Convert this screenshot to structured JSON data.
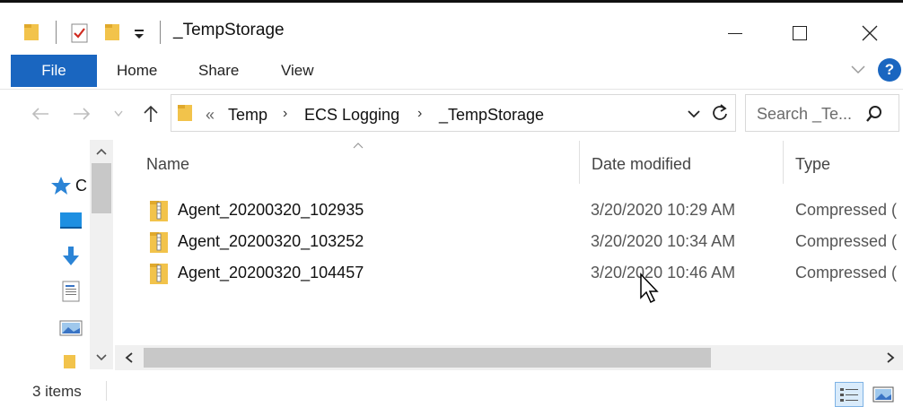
{
  "window": {
    "title": "_TempStorage",
    "minimize_glyph": "—",
    "maximize_glyph": "☐",
    "close_glyph": "✕"
  },
  "ribbon": {
    "file_label": "File",
    "tabs": [
      "Home",
      "Share",
      "View"
    ],
    "help_glyph": "?"
  },
  "address": {
    "overflow": "«",
    "crumbs": [
      "Temp",
      "ECS Logging",
      "_TempStorage"
    ],
    "separator": "›",
    "search_placeholder": "Search _Te..."
  },
  "columns": {
    "name": "Name",
    "date": "Date modified",
    "type": "Type"
  },
  "files": [
    {
      "name": "Agent_20200320_102935",
      "date": "3/20/2020 10:29 AM",
      "type": "Compressed ("
    },
    {
      "name": "Agent_20200320_103252",
      "date": "3/20/2020 10:34 AM",
      "type": "Compressed ("
    },
    {
      "name": "Agent_20200320_104457",
      "date": "3/20/2020 10:46 AM",
      "type": "Compressed ("
    }
  ],
  "nav": {
    "quick_access_partial": "C"
  },
  "status": {
    "items_text": "3 items"
  },
  "colors": {
    "accent": "#1a66c0",
    "folder": "#f2c34b"
  }
}
